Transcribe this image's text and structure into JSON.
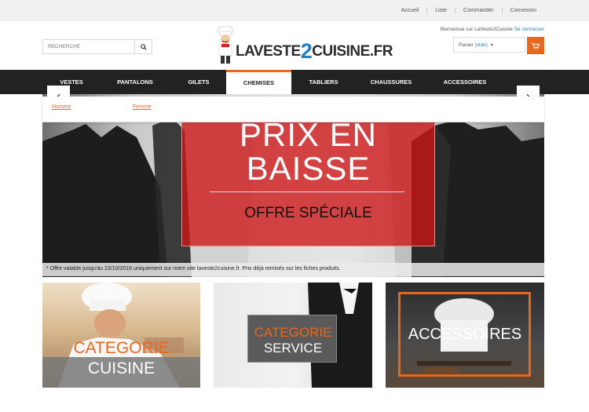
{
  "topbar": {
    "links": [
      "Accueil",
      "Liste",
      "Commander",
      "Connexion"
    ]
  },
  "header": {
    "search_placeholder": "RECHERCHE",
    "logo_text_left": "LAVESTE",
    "logo_text_mid": "2",
    "logo_text_right": "CUISINE.FR",
    "welcome_text": "Bienvenue sur LaVeste2Cuisine",
    "login_link": "Se connecter",
    "cart_label": "Panier",
    "cart_status": "(vide)"
  },
  "nav": {
    "items": [
      "VESTES",
      "PANTALONS",
      "GILETS",
      "CHEMISES",
      "TABLIERS",
      "CHAUSSURES",
      "ACCESSOIRES"
    ],
    "active": "CHEMISES"
  },
  "submenu": {
    "items": [
      "Homme",
      "Femme"
    ]
  },
  "slider": {
    "line1": "PRIX EN",
    "line2": "BAISSE",
    "line3": "OFFRE SPÉCIALE",
    "disclaimer": "* Offre valable jusqu'au 23/10/2016 uniquement sur notre site laveste2cuisine.fr. Prix déjà remisés sur les fiches produits."
  },
  "tiles": {
    "cuisine": {
      "category": "CATEGORIE",
      "name": "CUISINE"
    },
    "service": {
      "category": "CATEGORIE",
      "name": "SERVICE"
    },
    "accessoires": {
      "name": "ACCESSOIRES"
    }
  },
  "colors": {
    "accent": "#e8671d",
    "link": "#1f7fc4",
    "nav_bg": "#222222",
    "promo": "#cd1414"
  }
}
